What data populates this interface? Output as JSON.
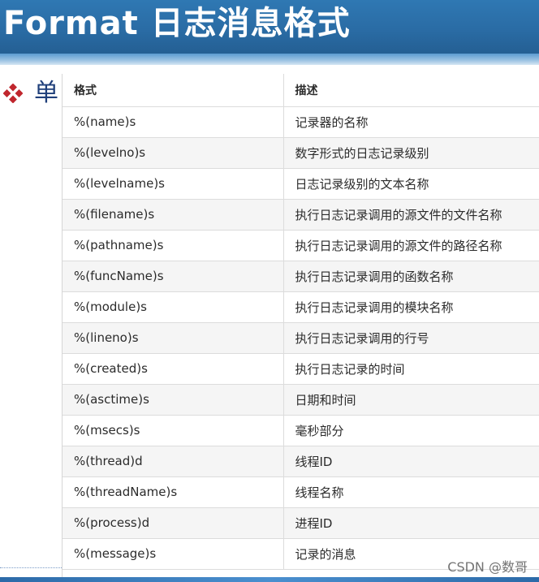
{
  "slide": {
    "title": "Format 日志消息格式",
    "bullet_text": "单",
    "watermark": "CSDN @数哥"
  },
  "table": {
    "headers": [
      "格式",
      "描述"
    ],
    "rows": [
      [
        "%(name)s",
        "记录器的名称"
      ],
      [
        "%(levelno)s",
        "数字形式的日志记录级别"
      ],
      [
        "%(levelname)s",
        "日志记录级别的文本名称"
      ],
      [
        "%(filename)s",
        "执行日志记录调用的源文件的文件名称"
      ],
      [
        "%(pathname)s",
        "执行日志记录调用的源文件的路径名称"
      ],
      [
        "%(funcName)s",
        "执行日志记录调用的函数名称"
      ],
      [
        "%(module)s",
        "执行日志记录调用的模块名称"
      ],
      [
        "%(lineno)s",
        "执行日志记录调用的行号"
      ],
      [
        "%(created)s",
        "执行日志记录的时间"
      ],
      [
        "%(asctime)s",
        "日期和时间"
      ],
      [
        "%(msecs)s",
        "毫秒部分"
      ],
      [
        "%(thread)d",
        "线程ID"
      ],
      [
        "%(threadName)s",
        "线程名称"
      ],
      [
        "%(process)d",
        "进程ID"
      ],
      [
        "%(message)s",
        "记录的消息"
      ]
    ]
  },
  "colors": {
    "header_bg": "#2a6ca5",
    "bullet_red": "#c0262d",
    "bullet_text": "#1f3f7a"
  },
  "icons": {
    "bullet": "diamond-bullet-icon"
  }
}
